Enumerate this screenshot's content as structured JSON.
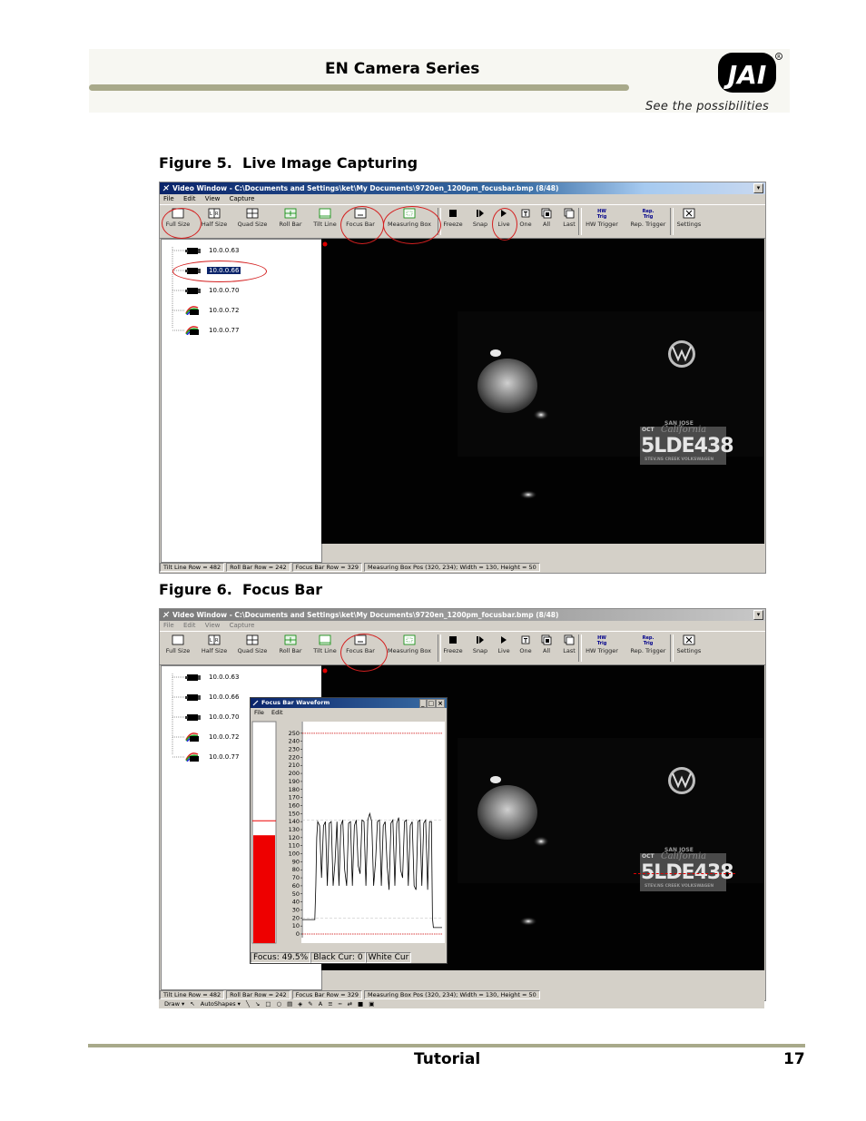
{
  "header": {
    "title": "EN Camera Series",
    "tagline": "See the possibilities",
    "logo_text": "JAI"
  },
  "figure5": {
    "label": "Figure 5.",
    "caption": "Live Image Capturing"
  },
  "figure6": {
    "label": "Figure 6.",
    "caption": "Focus Bar"
  },
  "window": {
    "title": "Video Window - C:\\Documents and Settings\\ket\\My Documents\\9720en_1200pm_focusbar.bmp (8/48)",
    "title_fig6": "Video Window - C:\\Documents and Settings\\ket\\My Documents\\9720en_1200pm_focusbar.bmp (8/48)",
    "menu": [
      "File",
      "Edit",
      "View",
      "Capture"
    ],
    "tools": [
      {
        "label": "Full Size",
        "icon": "full-size-icon"
      },
      {
        "label": "Half Size",
        "icon": "half-size-icon"
      },
      {
        "label": "Quad Size",
        "icon": "quad-size-icon"
      },
      {
        "label": "Roll Bar",
        "icon": "roll-bar-icon"
      },
      {
        "label": "Tilt Line",
        "icon": "tilt-line-icon"
      },
      {
        "label": "Focus Bar",
        "icon": "focus-bar-icon"
      },
      {
        "label": "Measuring Box",
        "icon": "measuring-box-icon"
      },
      {
        "label": "Freeze",
        "icon": "stop-icon"
      },
      {
        "label": "Snap",
        "icon": "snap-icon"
      },
      {
        "label": "Live",
        "icon": "play-icon"
      },
      {
        "label": "One",
        "icon": "one-icon"
      },
      {
        "label": "All",
        "icon": "all-icon"
      },
      {
        "label": "Last",
        "icon": "last-icon"
      },
      {
        "label": "HW Trigger",
        "icon": "hw-trigger-icon",
        "badge": "HW\nTrig"
      },
      {
        "label": "Rep. Trigger",
        "icon": "rep-trigger-icon",
        "badge": "Rep.\nTrig"
      },
      {
        "label": "Settings",
        "icon": "settings-icon"
      }
    ],
    "cameras": [
      {
        "ip": "10.0.0.63",
        "icon": "camera-icon"
      },
      {
        "ip": "10.0.0.66",
        "icon": "camera-icon"
      },
      {
        "ip": "10.0.0.70",
        "icon": "camera-icon"
      },
      {
        "ip": "10.0.0.72",
        "icon": "color-camera-icon"
      },
      {
        "ip": "10.0.0.77",
        "icon": "color-camera-icon"
      }
    ],
    "selected_camera_fig5": "10.0.0.66",
    "status": [
      "Tilt Line Row = 482",
      "Roll Bar Row = 242",
      "Focus Bar Row = 329",
      "Measuring Box Pos (320, 234); Width = 130, Height = 50"
    ],
    "plate_text": "5LDE438",
    "plate_top": "SAN JOSE",
    "plate_state": "California",
    "plate_bottom": "STEV.NS CREEK VOLKSWAGEN",
    "plate_month": "OCT"
  },
  "focus_popup": {
    "title": "Focus Bar Waveform",
    "menu": [
      "File",
      "Edit"
    ],
    "focus": "Focus: 49.5%",
    "black": "Black Cur: 0",
    "white": "White Cur",
    "bar_fill_fraction": 0.495
  },
  "chart_data": {
    "type": "line",
    "title": "",
    "xlabel": "",
    "ylabel": "",
    "ylim": [
      0,
      260
    ],
    "yticks": [
      0,
      10,
      20,
      30,
      40,
      50,
      60,
      70,
      80,
      90,
      100,
      110,
      120,
      130,
      140,
      150,
      160,
      170,
      180,
      190,
      200,
      210,
      220,
      230,
      240,
      250
    ],
    "red_lines": [
      0,
      250
    ],
    "dashed_lines": [
      20,
      142
    ],
    "x": [
      0,
      5,
      10,
      13,
      14,
      15,
      16,
      18,
      20,
      22,
      24,
      26,
      28,
      30,
      32,
      34,
      36,
      38,
      40,
      42,
      44,
      46,
      48,
      50,
      52,
      54,
      56,
      58,
      60,
      62,
      64,
      66,
      68,
      70,
      72,
      74,
      76,
      78,
      80,
      82,
      84,
      86,
      88,
      90,
      92,
      94,
      96,
      98,
      100,
      102,
      104,
      106,
      108,
      110,
      112,
      114,
      116,
      118,
      120,
      122,
      124,
      126,
      128,
      130,
      132,
      134,
      135,
      136,
      137,
      140,
      145
    ],
    "values": [
      18,
      18,
      18,
      18,
      60,
      120,
      140,
      135,
      70,
      135,
      140,
      60,
      138,
      140,
      60,
      90,
      140,
      60,
      135,
      142,
      80,
      60,
      138,
      140,
      60,
      135,
      142,
      85,
      75,
      142,
      140,
      60,
      142,
      150,
      140,
      60,
      90,
      140,
      142,
      60,
      135,
      140,
      85,
      55,
      138,
      142,
      60,
      138,
      145,
      80,
      70,
      140,
      142,
      60,
      135,
      140,
      60,
      55,
      140,
      142,
      60,
      138,
      142,
      55,
      140,
      140,
      20,
      8,
      8,
      8,
      8
    ]
  },
  "footer": {
    "section": "Tutorial",
    "page": "17"
  }
}
